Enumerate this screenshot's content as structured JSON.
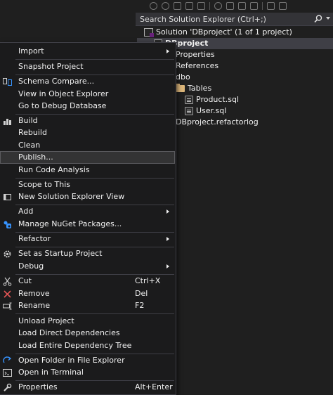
{
  "explorer": {
    "search_placeholder": "Search Solution Explorer (Ctrl+;)",
    "solution_label": "Solution 'DBproject' (1 of 1 project)",
    "project_label": "DBproject",
    "tree": [
      {
        "label": "Properties"
      },
      {
        "label": "References"
      },
      {
        "label": "dbo"
      },
      {
        "label": "Tables"
      },
      {
        "label": "Product.sql"
      },
      {
        "label": "User.sql"
      },
      {
        "label": "DBproject.refactorlog"
      }
    ]
  },
  "menu": {
    "import": "Import",
    "snapshot": "Snapshot Project",
    "schema_compare": "Schema Compare...",
    "view_object_explorer": "View in Object Explorer",
    "go_debug_db": "Go to Debug Database",
    "build": "Build",
    "rebuild": "Rebuild",
    "clean": "Clean",
    "publish": "Publish...",
    "run_code_analysis": "Run Code Analysis",
    "scope_to_this": "Scope to This",
    "new_se_view": "New Solution Explorer View",
    "add": "Add",
    "manage_nuget": "Manage NuGet Packages...",
    "refactor": "Refactor",
    "set_startup": "Set as Startup Project",
    "debug": "Debug",
    "cut": "Cut",
    "cut_shortcut": "Ctrl+X",
    "remove": "Remove",
    "remove_shortcut": "Del",
    "rename": "Rename",
    "rename_shortcut": "F2",
    "unload": "Unload Project",
    "load_direct": "Load Direct Dependencies",
    "load_tree": "Load Entire Dependency Tree",
    "open_folder": "Open Folder in File Explorer",
    "open_terminal": "Open in Terminal",
    "properties": "Properties",
    "properties_shortcut": "Alt+Enter"
  },
  "colors": {
    "menu_bg": "#1b1b1c",
    "highlight": "#333334",
    "folder": "#dcb67a",
    "remove_red": "#e05454",
    "accent_blue": "#3794ff"
  }
}
